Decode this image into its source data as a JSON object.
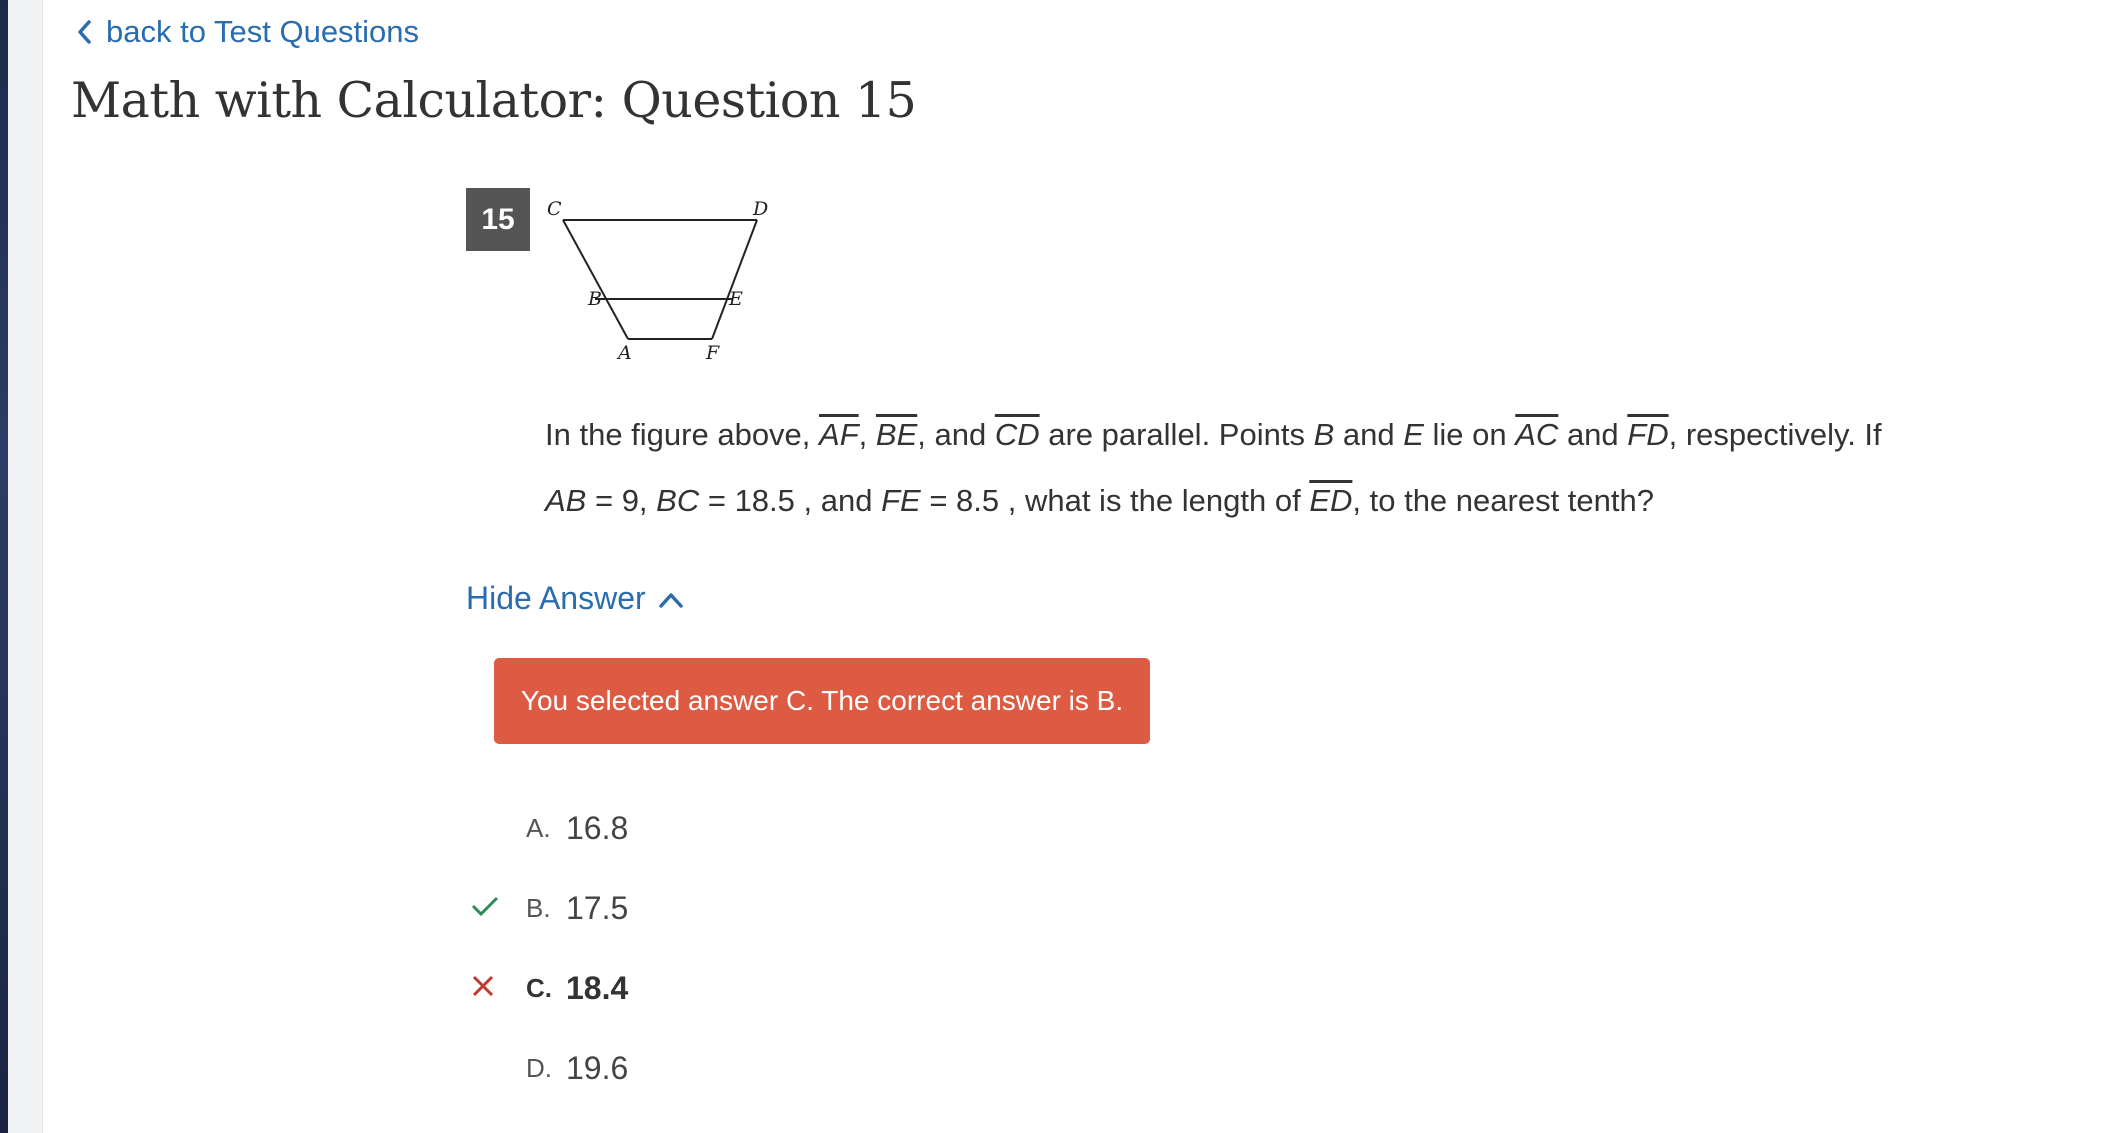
{
  "nav": {
    "back_label": "back to Test Questions"
  },
  "page": {
    "title": "Math with Calculator: Question 15"
  },
  "question": {
    "number": "15",
    "figure_labels": {
      "C": "C",
      "D": "D",
      "B": "B",
      "E": "E",
      "A": "A",
      "F": "F"
    },
    "text": {
      "p1": "In the figure above, ",
      "af": "AF",
      "c1": ", ",
      "be": "BE",
      "c2": ", and ",
      "cd": "CD",
      "p2": " are parallel. Points ",
      "b": "B",
      "p3": " and ",
      "e": "E",
      "p4": " lie on ",
      "ac": "AC",
      "p5": " and ",
      "fd": "FD",
      "p6": ", respectively. If ",
      "ab": "AB",
      "eq1": " = 9, ",
      "bc": "BC",
      "eq2": " = 18.5 , and ",
      "fe": "FE",
      "eq3": " = 8.5 , what is the length of ",
      "ed": "ED",
      "p7": ", to the nearest tenth?"
    }
  },
  "answer_toggle": {
    "label": "Hide Answer",
    "icon": "chevron-up-icon"
  },
  "feedback": {
    "text": "You selected answer C. The correct answer is B.",
    "color": "#dd5a43"
  },
  "choices": [
    {
      "letter": "A.",
      "value": "16.8",
      "status": "none"
    },
    {
      "letter": "B.",
      "value": "17.5",
      "status": "correct"
    },
    {
      "letter": "C.",
      "value": "18.4",
      "status": "selected-wrong"
    },
    {
      "letter": "D.",
      "value": "19.6",
      "status": "none"
    }
  ],
  "colors": {
    "link": "#2a6cb0",
    "correct": "#2e8a5a",
    "wrong": "#c0392b"
  }
}
